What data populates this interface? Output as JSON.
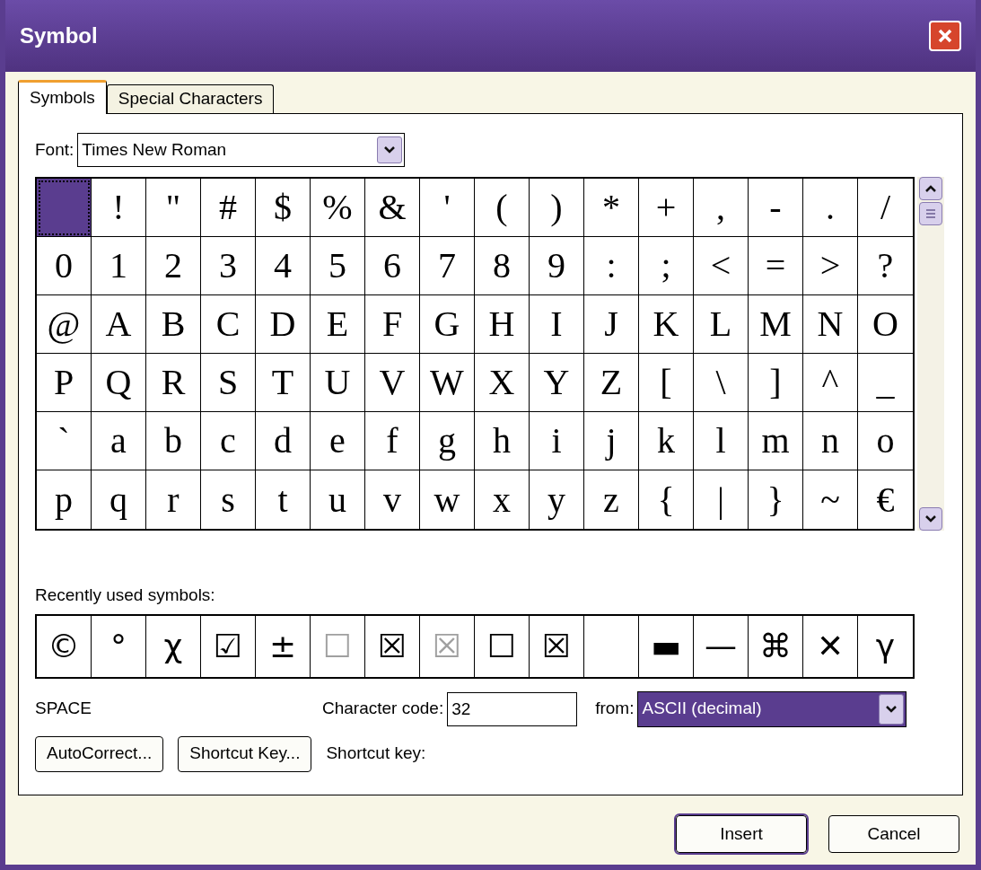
{
  "window": {
    "title": "Symbol"
  },
  "tabs": [
    {
      "label": "Symbols",
      "selected": true
    },
    {
      "label": "Special Characters",
      "selected": false
    }
  ],
  "font": {
    "label": "Font:",
    "value": "Times New Roman"
  },
  "grid": [
    [
      {
        "selected": true
      },
      {
        "char": "!",
        "selected": false
      },
      {
        "char": "\"",
        "selected": false
      },
      {
        "char": "#",
        "selected": false
      },
      {
        "char": "$",
        "selected": false
      },
      {
        "char": "%",
        "selected": false
      },
      {
        "char": "&",
        "selected": false
      },
      {
        "char": "'",
        "selected": false
      },
      {
        "char": "(",
        "selected": false
      },
      {
        "char": ")",
        "selected": false
      },
      {
        "char": "*",
        "selected": false
      },
      {
        "char": "+",
        "selected": false
      },
      {
        "char": ",",
        "selected": false
      },
      {
        "char": "-",
        "selected": false
      },
      {
        "char": ".",
        "selected": false
      },
      {
        "char": "/",
        "selected": false
      }
    ],
    [
      {
        "char": "0",
        "selected": false
      },
      {
        "char": "1",
        "selected": false
      },
      {
        "char": "2",
        "selected": false
      },
      {
        "char": "3",
        "selected": false
      },
      {
        "char": "4",
        "selected": false
      },
      {
        "char": "5",
        "selected": false
      },
      {
        "char": "6",
        "selected": false
      },
      {
        "char": "7",
        "selected": false
      },
      {
        "char": "8",
        "selected": false
      },
      {
        "char": "9",
        "selected": false
      },
      {
        "char": ":",
        "selected": false
      },
      {
        "char": ";",
        "selected": false
      },
      {
        "char": "<",
        "selected": false
      },
      {
        "char": "=",
        "selected": false
      },
      {
        "char": ">",
        "selected": false
      },
      {
        "char": "?",
        "selected": false
      }
    ],
    [
      {
        "char": "@",
        "selected": false
      },
      {
        "char": "A",
        "selected": false
      },
      {
        "char": "B",
        "selected": false
      },
      {
        "char": "C",
        "selected": false
      },
      {
        "char": "D",
        "selected": false
      },
      {
        "char": "E",
        "selected": false
      },
      {
        "char": "F",
        "selected": false
      },
      {
        "char": "G",
        "selected": false
      },
      {
        "char": "H",
        "selected": false
      },
      {
        "char": "I",
        "selected": false
      },
      {
        "char": "J",
        "selected": false
      },
      {
        "char": "K",
        "selected": false
      },
      {
        "char": "L",
        "selected": false
      },
      {
        "char": "M",
        "selected": false
      },
      {
        "char": "N",
        "selected": false
      },
      {
        "char": "O",
        "selected": false
      }
    ],
    [
      {
        "char": "P",
        "selected": false
      },
      {
        "char": "Q",
        "selected": false
      },
      {
        "char": "R",
        "selected": false
      },
      {
        "char": "S",
        "selected": false
      },
      {
        "char": "T",
        "selected": false
      },
      {
        "char": "U",
        "selected": false
      },
      {
        "char": "V",
        "selected": false
      },
      {
        "char": "W",
        "selected": false
      },
      {
        "char": "X",
        "selected": false
      },
      {
        "char": "Y",
        "selected": false
      },
      {
        "char": "Z",
        "selected": false
      },
      {
        "char": "[",
        "selected": false
      },
      {
        "char": "\\",
        "selected": false
      },
      {
        "char": "]",
        "selected": false
      },
      {
        "char": "^",
        "selected": false
      },
      {
        "char": "_",
        "selected": false
      }
    ],
    [
      {
        "char": "`",
        "selected": false
      },
      {
        "char": "a",
        "selected": false
      },
      {
        "char": "b",
        "selected": false
      },
      {
        "char": "c",
        "selected": false
      },
      {
        "char": "d",
        "selected": false
      },
      {
        "char": "e",
        "selected": false
      },
      {
        "char": "f",
        "selected": false
      },
      {
        "char": "g",
        "selected": false
      },
      {
        "char": "h",
        "selected": false
      },
      {
        "char": "i",
        "selected": false
      },
      {
        "char": "j",
        "selected": false
      },
      {
        "char": "k",
        "selected": false
      },
      {
        "char": "l",
        "selected": false
      },
      {
        "char": "m",
        "selected": false
      },
      {
        "char": "n",
        "selected": false
      },
      {
        "char": "o",
        "selected": false
      }
    ],
    [
      {
        "char": "p",
        "selected": false
      },
      {
        "char": "q",
        "selected": false
      },
      {
        "char": "r",
        "selected": false
      },
      {
        "char": "s",
        "selected": false
      },
      {
        "char": "t",
        "selected": false
      },
      {
        "char": "u",
        "selected": false
      },
      {
        "char": "v",
        "selected": false
      },
      {
        "char": "w",
        "selected": false
      },
      {
        "char": "x",
        "selected": false
      },
      {
        "char": "y",
        "selected": false
      },
      {
        "char": "z",
        "selected": false
      },
      {
        "char": "{",
        "selected": false
      },
      {
        "char": "|",
        "selected": false
      },
      {
        "char": "}",
        "selected": false
      },
      {
        "char": "~",
        "selected": false
      },
      {
        "char": "€",
        "selected": false
      }
    ]
  ],
  "recent": {
    "label": "Recently used symbols:",
    "symbols": [
      {
        "kind": "symbol",
        "char": "©",
        "faded": false
      },
      {
        "kind": "symbol",
        "char": "°",
        "faded": false
      },
      {
        "kind": "symbol",
        "char": "χ",
        "faded": false
      },
      {
        "kind": "symbol",
        "char": "☑",
        "faded": false
      },
      {
        "kind": "symbol",
        "char": "±",
        "faded": false
      },
      {
        "kind": "symbol",
        "char": "☐",
        "faded": true
      },
      {
        "kind": "symbol",
        "char": "☒",
        "faded": false
      },
      {
        "kind": "symbol",
        "char": "☒",
        "faded": true
      },
      {
        "kind": "symbol",
        "char": "☐",
        "faded": false
      },
      {
        "kind": "symbol",
        "char": "☒",
        "faded": false
      },
      {
        "kind": "blank"
      },
      {
        "kind": "symbol",
        "char": "▬",
        "faded": false
      },
      {
        "kind": "symbol",
        "char": "—",
        "faded": false
      },
      {
        "kind": "symbol",
        "char": "⌘",
        "faded": false
      },
      {
        "kind": "symbol",
        "char": "✕",
        "faded": false
      },
      {
        "kind": "symbol",
        "char": "γ",
        "faded": false
      }
    ]
  },
  "char_name": "SPACE",
  "char_code": {
    "label": "Character code:",
    "value": "32"
  },
  "from": {
    "label": "from:",
    "value": "ASCII (decimal)"
  },
  "buttons": [
    "AutoCorrect...",
    "Shortcut Key..."
  ],
  "shortcut_label": "Shortcut key:",
  "footer_buttons": [
    "Insert",
    "Cancel"
  ]
}
